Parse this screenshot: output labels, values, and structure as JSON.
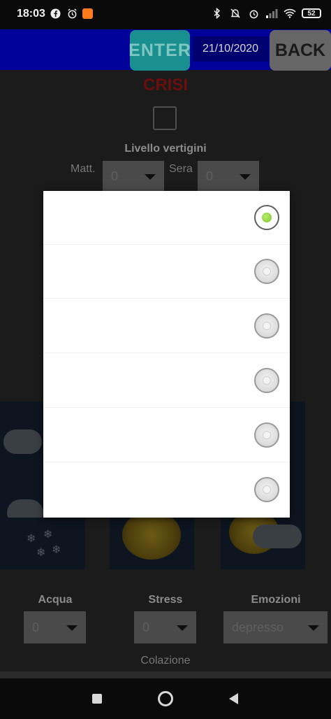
{
  "status_bar": {
    "time": "18:03",
    "battery": "52"
  },
  "header": {
    "enter_label": "ENTER",
    "date": "21/10/2020",
    "back_label": "BACK"
  },
  "form": {
    "crisi_label": "CRISI",
    "vertigo_label": "Livello vertigini",
    "morning_label": "Matt.",
    "morning_value": "0",
    "evening_label": "Sera",
    "evening_value": "0",
    "water_label": "Acqua",
    "water_value": "0",
    "stress_label": "Stress",
    "stress_value": "0",
    "emotions_label": "Emozioni",
    "emotions_value": "depresso",
    "breakfast_label": "Colazione"
  },
  "dialog": {
    "selected_index": 0,
    "options": [
      {
        "label": "",
        "selected": true
      },
      {
        "label": "",
        "selected": false
      },
      {
        "label": "",
        "selected": false
      },
      {
        "label": "",
        "selected": false
      },
      {
        "label": "",
        "selected": false
      },
      {
        "label": "",
        "selected": false
      }
    ]
  },
  "colors": {
    "header_bg": "#00009a",
    "enter_bg": "#1a8f8f",
    "back_bg": "#666666",
    "crisi": "#6a0e0e",
    "radio_selected": "#7cc12b"
  }
}
